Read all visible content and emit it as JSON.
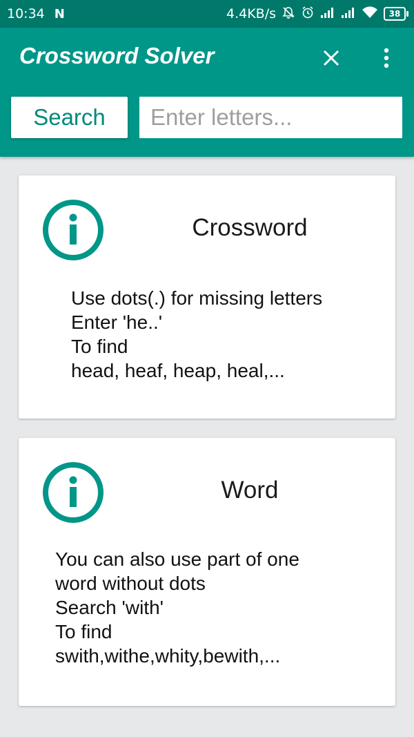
{
  "status_bar": {
    "time": "10:34",
    "notification_icon": "n-logo-icon",
    "net_speed": "4.4KB/s",
    "battery": "38"
  },
  "app_bar": {
    "title": "Crossword Solver",
    "search_button_label": "Search",
    "search_placeholder": "Enter letters...",
    "search_value": ""
  },
  "cards": [
    {
      "icon": "info-icon",
      "title": "Crossword",
      "lines": [
        "Use dots(.) for missing letters",
        "Enter 'he..'",
        "To find",
        "head, heaf, heap, heal,..."
      ]
    },
    {
      "icon": "info-icon",
      "title": "Word",
      "lines": [
        "You can also use part of one",
        "word without dots",
        "Search 'with'",
        "To find",
        "swith,withe,whity,bewith,..."
      ]
    }
  ],
  "colors": {
    "status_bar": "#00796b",
    "app_bar": "#009688",
    "accent": "#00897b",
    "background": "#e6e8e9"
  }
}
